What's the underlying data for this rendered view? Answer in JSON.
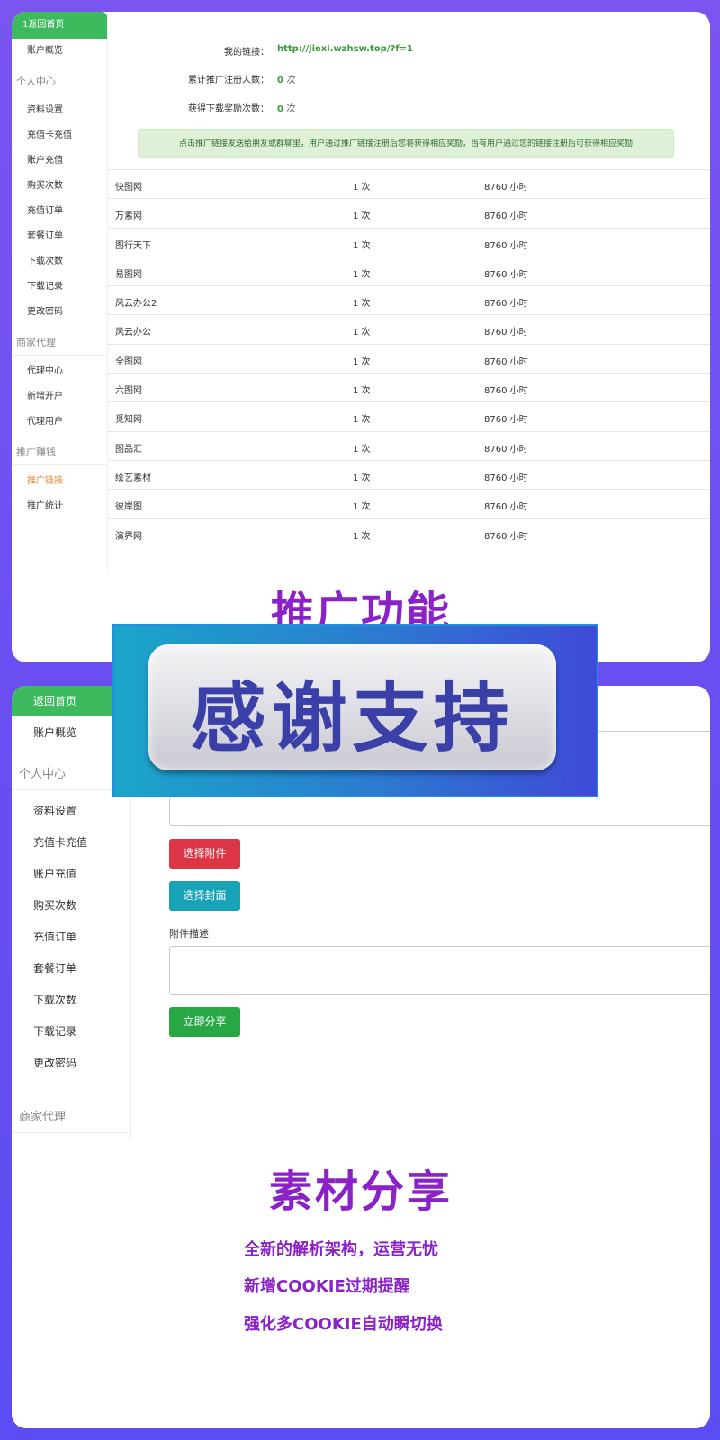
{
  "card1": {
    "sidebar": {
      "home": "1返回首页",
      "overview": "账户概览",
      "sections": [
        {
          "title": "个人中心",
          "items": [
            "资料设置",
            "充值卡充值",
            "账户充值",
            "购买次数",
            "充值订单",
            "套餐订单",
            "下载次数",
            "下载记录",
            "更改密码"
          ]
        },
        {
          "title": "商家代理",
          "items": [
            "代理中心",
            "新增开户",
            "代理用户"
          ]
        },
        {
          "title": "推广赚钱",
          "items": [
            "推广链接",
            "推广统计"
          ]
        }
      ]
    },
    "info": {
      "link_label": "我的链接：",
      "link_value": "http://jiexi.wzhsw.top/?f=1",
      "reg_label": "累计推广注册人数：",
      "reg_value": "0",
      "reg_unit": "次",
      "reward_label": "获得下载奖励次数：",
      "reward_value": "0",
      "reward_unit": "次"
    },
    "notice": "点击推广链接发送给朋友或群聊里，用户通过推广链接注册后您将获得相应奖励，当有用户通过您的链接注册后可获得相应奖励",
    "rows": [
      {
        "name": "快图网",
        "times": "1 次",
        "hours": "8760 小时"
      },
      {
        "name": "万素网",
        "times": "1 次",
        "hours": "8760 小时"
      },
      {
        "name": "图行天下",
        "times": "1 次",
        "hours": "8760 小时"
      },
      {
        "name": "易图网",
        "times": "1 次",
        "hours": "8760 小时"
      },
      {
        "name": "风云办公2",
        "times": "1 次",
        "hours": "8760 小时"
      },
      {
        "name": "风云办公",
        "times": "1 次",
        "hours": "8760 小时"
      },
      {
        "name": "全图网",
        "times": "1 次",
        "hours": "8760 小时"
      },
      {
        "name": "六图网",
        "times": "1 次",
        "hours": "8760 小时"
      },
      {
        "name": "觅知网",
        "times": "1 次",
        "hours": "8760 小时"
      },
      {
        "name": "图品汇",
        "times": "1 次",
        "hours": "8760 小时"
      },
      {
        "name": "绘艺素材",
        "times": "1 次",
        "hours": "8760 小时"
      },
      {
        "name": "彼岸图",
        "times": "1 次",
        "hours": "8760 小时"
      },
      {
        "name": "演界网",
        "times": "1 次",
        "hours": "8760 小时"
      }
    ],
    "title": "推广功能"
  },
  "banner": {
    "text": "感谢支持"
  },
  "card2": {
    "sidebar": {
      "home": "返回首页",
      "overview": "账户概览",
      "section1": "个人中心",
      "items": [
        "资料设置",
        "充值卡充值",
        "账户充值",
        "购买次数",
        "充值订单",
        "套餐订单",
        "下载次数",
        "下载记录",
        "更改密码"
      ],
      "section2": "商家代理"
    },
    "form": {
      "attach_button": "选择附件",
      "cover_button": "选择封面",
      "desc_label": "附件描述",
      "share_button": "立即分享"
    },
    "title": "素材分享",
    "features": [
      "全新的解析架构，运营无忧",
      "新增COOKIE过期提醒",
      "强化多COOKIE自动瞬切换"
    ]
  }
}
